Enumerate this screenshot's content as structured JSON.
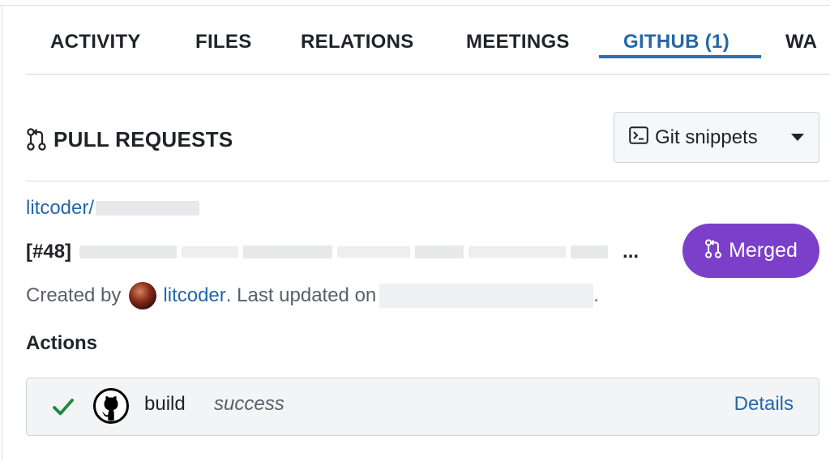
{
  "tabs": [
    {
      "label": "ACTIVITY"
    },
    {
      "label": "FILES"
    },
    {
      "label": "RELATIONS"
    },
    {
      "label": "MEETINGS"
    },
    {
      "label": "GITHUB (1)",
      "active": true
    },
    {
      "label": "WA"
    }
  ],
  "section": {
    "title": "PULL REQUESTS",
    "snippets_label": "Git snippets"
  },
  "pull_request": {
    "repo_prefix": "litcoder/",
    "number": "[#48]",
    "ellipsis": "...",
    "status": "Merged",
    "created_prefix": "Created by",
    "author": "litcoder",
    "updated_prefix": ". Last updated on",
    "updated_suffix": "."
  },
  "actions": {
    "title": "Actions",
    "items": [
      {
        "name": "build",
        "status": "success",
        "details_label": "Details"
      }
    ]
  },
  "colors": {
    "accent": "#2467a8",
    "merged": "#7b3fc9",
    "success": "#1f883d"
  }
}
